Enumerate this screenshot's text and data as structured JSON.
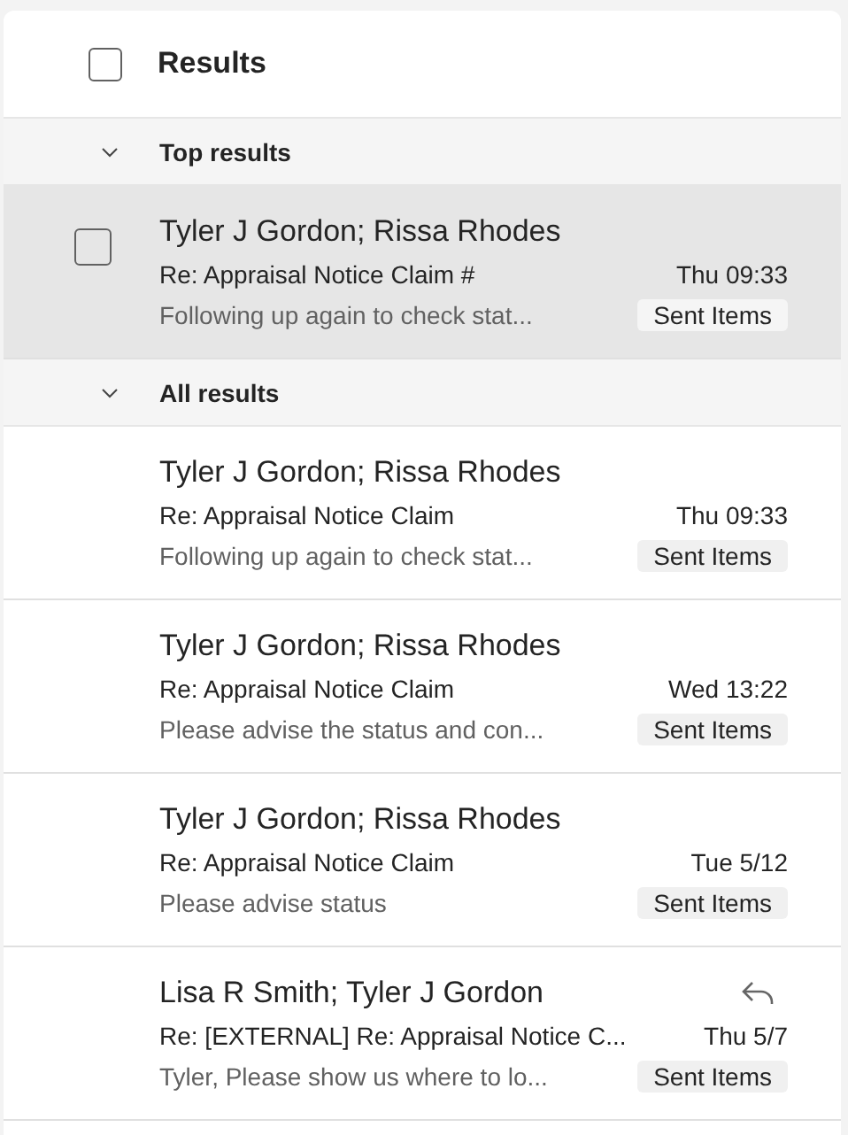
{
  "header": {
    "title": "Results",
    "checked": false
  },
  "groups": [
    {
      "label": "Top results",
      "expanded": true,
      "items": [
        {
          "sender": "Tyler J Gordon; Rissa Rhodes",
          "subject": "Re: Appraisal Notice Claim #",
          "date": "Thu 09:33",
          "preview": "Following up again to check stat...",
          "folder": "Sent Items",
          "selected": true,
          "replied": false
        }
      ]
    },
    {
      "label": "All results",
      "expanded": true,
      "items": [
        {
          "sender": "Tyler J Gordon; Rissa Rhodes",
          "subject": "Re: Appraisal Notice Claim",
          "date": "Thu 09:33",
          "preview": "Following up again to check stat...",
          "folder": "Sent Items",
          "selected": false,
          "replied": false
        },
        {
          "sender": "Tyler J Gordon; Rissa Rhodes",
          "subject": "Re: Appraisal Notice Claim",
          "date": "Wed 13:22",
          "preview": "Please advise the status and con...",
          "folder": "Sent Items",
          "selected": false,
          "replied": false
        },
        {
          "sender": "Tyler J Gordon; Rissa Rhodes",
          "subject": "Re: Appraisal Notice Claim",
          "date": "Tue 5/12",
          "preview": "Please advise status",
          "folder": "Sent Items",
          "selected": false,
          "replied": false
        },
        {
          "sender": "Lisa R Smith; Tyler J Gordon",
          "subject": "Re: [EXTERNAL] Re: Appraisal Notice C...",
          "date": "Thu 5/7",
          "preview": "Tyler, Please show us where to lo...",
          "folder": "Sent Items",
          "selected": false,
          "replied": true
        }
      ]
    }
  ]
}
